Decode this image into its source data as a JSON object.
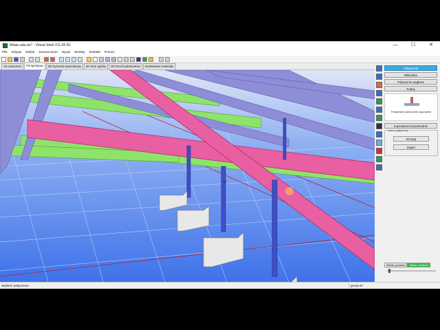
{
  "window": {
    "title": "Wiata cała.stv* - Virtual Steel V11.00 R1",
    "controls": {
      "minimize": "—",
      "maximize": "☐",
      "close": "✕"
    }
  },
  "menu": [
    "Plik",
    "Edycja",
    "Widok",
    "Zaznaczenie",
    "Opcje",
    "Moduły",
    "Dodatki",
    "Pomoc"
  ],
  "tabs": [
    {
      "label": "Ak.conversrie",
      "active": false
    },
    {
      "label": "Perspektywa",
      "active": true
    },
    {
      "label": "2D Rysunek warsztatowy",
      "active": false
    },
    {
      "label": "2D Rzut ogólny",
      "active": false
    },
    {
      "label": "2D Rzut fundamentów",
      "active": false
    },
    {
      "label": "Zestawienie materiału",
      "active": false
    }
  ],
  "right_panel": {
    "buttons": [
      {
        "label": "Połączenia",
        "active": true
      },
      {
        "label": "Biblioteka",
        "active": false
      },
      {
        "label": "Połączenie węgłowe",
        "active": false
      },
      {
        "label": "Kopiuj",
        "active": false
      }
    ],
    "preview_label": "Podpierane płatw przez łączowniki",
    "copy_button": "Kopiowanie bezpośrednie",
    "group_title": "Dane połączenia",
    "group_buttons": [
      "Wczytaj",
      "Zapisz"
    ],
    "filter_tabs": [
      {
        "label": "Widok: punktów",
        "active": false
      },
      {
        "label": "Widok: obrysów",
        "active": true
      }
    ]
  },
  "status": {
    "left": "Wybierz połączenia",
    "right": "group 67"
  },
  "colors": {
    "accent": "#3fa8e0",
    "pink_beam": "#e85fa2",
    "green_purlin": "#8ee36a",
    "blue_beam": "#8e8ed8",
    "ground": "#4c7ff0"
  },
  "icons": {
    "toolbar": [
      "new-icon",
      "open-icon",
      "save-icon",
      "print-icon",
      "undo-icon",
      "redo-icon",
      "zoom-in-icon",
      "zoom-out-icon",
      "zoom-fit-icon",
      "render-icon",
      "layer-icon"
    ],
    "vtoolbar": [
      "beam-icon",
      "column-icon",
      "grid-icon",
      "plate-icon",
      "bolt-icon",
      "weld-icon",
      "section-icon",
      "camera-icon",
      "cut-icon",
      "rotate-icon",
      "measure-icon",
      "stair-icon",
      "list-icon"
    ]
  }
}
